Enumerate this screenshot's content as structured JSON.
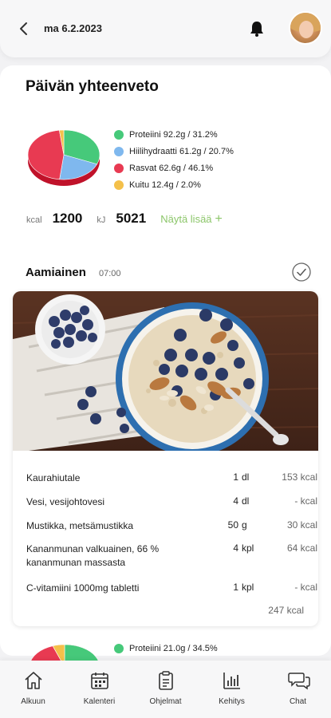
{
  "header": {
    "date": "ma 6.2.2023",
    "back_icon": "chevron-left-icon",
    "bell_icon": "bell-icon"
  },
  "summary": {
    "title": "Päivän yhteenveto",
    "macros": [
      {
        "label": "Proteiini 92.2g / 31.2%",
        "color": "#46c97a",
        "share": 31.2
      },
      {
        "label": "Hiilihydraatti 61.2g / 20.7%",
        "color": "#7fb8ee",
        "share": 20.7
      },
      {
        "label": "Rasvat 62.6g / 46.1%",
        "color": "#e83a52",
        "share": 46.1
      },
      {
        "label": "Kuitu 12.4g / 2.0%",
        "color": "#f4c04a",
        "share": 2.0
      }
    ],
    "kcal_unit": "kcal",
    "kcal_value": "1200",
    "kj_unit": "kJ",
    "kj_value": "5021",
    "show_more": "Näytä lisää",
    "show_more_icon": "+"
  },
  "meal": {
    "title": "Aamiainen",
    "time": "07:00",
    "check_icon": "check-circle-icon",
    "items": [
      {
        "name": "Kaurahiutale",
        "qty": "1",
        "unit": "dl",
        "kcal": "153 kcal"
      },
      {
        "name": "Vesi, vesijohtovesi",
        "qty": "4",
        "unit": "dl",
        "kcal": "- kcal"
      },
      {
        "name": "Mustikka, metsämustikka",
        "qty": "50",
        "unit": "g",
        "kcal": "30 kcal"
      },
      {
        "name": "Kananmunan valkuainen, 66 % kananmunan massasta",
        "qty": "4",
        "unit": "kpl",
        "kcal": "64 kcal"
      },
      {
        "name": "C-vitamiini 1000mg tabletti",
        "qty": "1",
        "unit": "kpl",
        "kcal": "- kcal"
      }
    ],
    "total": "247 kcal",
    "macros": [
      {
        "label": "Proteiini 21.0g / 34.5%",
        "color": "#46c97a",
        "share": 34.5
      },
      {
        "label": "",
        "color": "#7fb8ee",
        "share": 25
      },
      {
        "label": "",
        "color": "#e83a52",
        "share": 35
      },
      {
        "label": "",
        "color": "#f4c04a",
        "share": 5.5
      }
    ]
  },
  "tabs": [
    {
      "label": "Alkuun",
      "icon": "home-icon"
    },
    {
      "label": "Kalenteri",
      "icon": "calendar-icon"
    },
    {
      "label": "Ohjelmat",
      "icon": "clipboard-icon"
    },
    {
      "label": "Kehitys",
      "icon": "bar-chart-icon"
    },
    {
      "label": "Chat",
      "icon": "chat-icon"
    }
  ]
}
